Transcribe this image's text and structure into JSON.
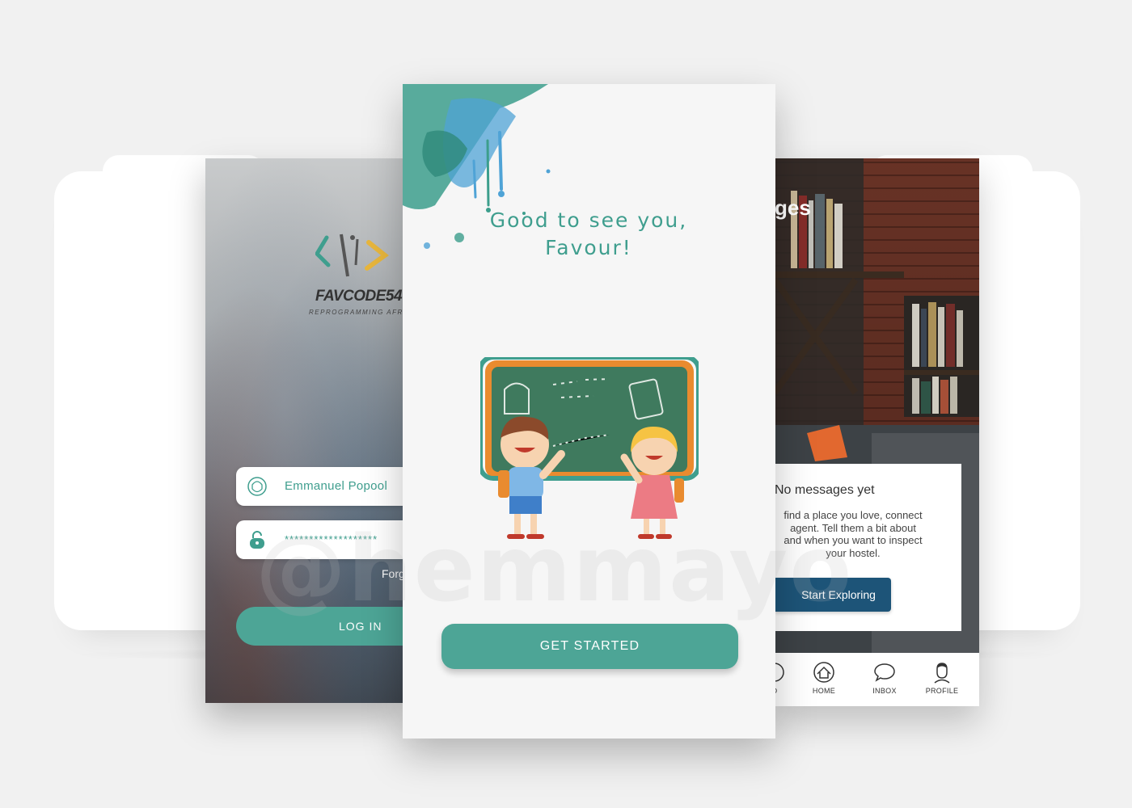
{
  "login_screen": {
    "brand_name": "FAVCODE54",
    "brand_tagline": "REPROGRAMMING AFRIC",
    "username_value": "Emmanuel Popool",
    "password_value": "*******************",
    "forgot_label": "Forg",
    "login_button": "LOG IN"
  },
  "welcome_screen": {
    "greeting_line1": "Good to see you,",
    "greeting_line2": "Favour!",
    "get_started_button": "GET STARTED"
  },
  "messages_screen": {
    "title_fragment": "ges",
    "empty_title": "No messages yet",
    "empty_body": [
      "find a place you love, connect",
      "agent. Tell them a bit about",
      "and when you want to inspect",
      "your hostel."
    ],
    "explore_button": "Start Exploring",
    "tabs": [
      {
        "label": "D",
        "icon": "saved-icon"
      },
      {
        "label": "HOME",
        "icon": "home-icon"
      },
      {
        "label": "INBOX",
        "icon": "inbox-icon"
      },
      {
        "label": "PROFILE",
        "icon": "profile-icon"
      }
    ]
  },
  "watermark": "@hemmayo",
  "colors": {
    "teal": "#4da596",
    "teal_text": "#3f9e8e",
    "navy": "#1d5478",
    "background": "#f1f1f1"
  }
}
